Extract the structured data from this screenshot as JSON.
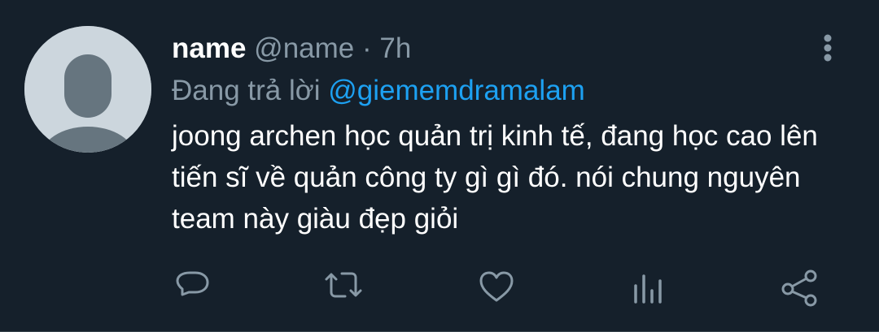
{
  "tweet": {
    "display_name": "name",
    "handle": "@name",
    "separator": "·",
    "time": "7h",
    "reply_prefix": "Đang trả lời",
    "reply_mention": "@giememdramalam",
    "text": "joong archen học quản trị kinh tế, đang học cao lên tiến sĩ về quản công ty gì gì đó. nói chung nguyên team này giàu đẹp giỏi"
  },
  "icons": {
    "more": "more-vertical-icon",
    "reply": "reply-icon",
    "retweet": "retweet-icon",
    "like": "heart-icon",
    "analytics": "analytics-icon",
    "share": "share-icon"
  },
  "colors": {
    "background": "#15202b",
    "text_primary": "#ffffff",
    "text_secondary": "#8899a6",
    "accent": "#1da1f2",
    "avatar_bg": "#ccd6dd",
    "avatar_fg": "#66757f"
  }
}
